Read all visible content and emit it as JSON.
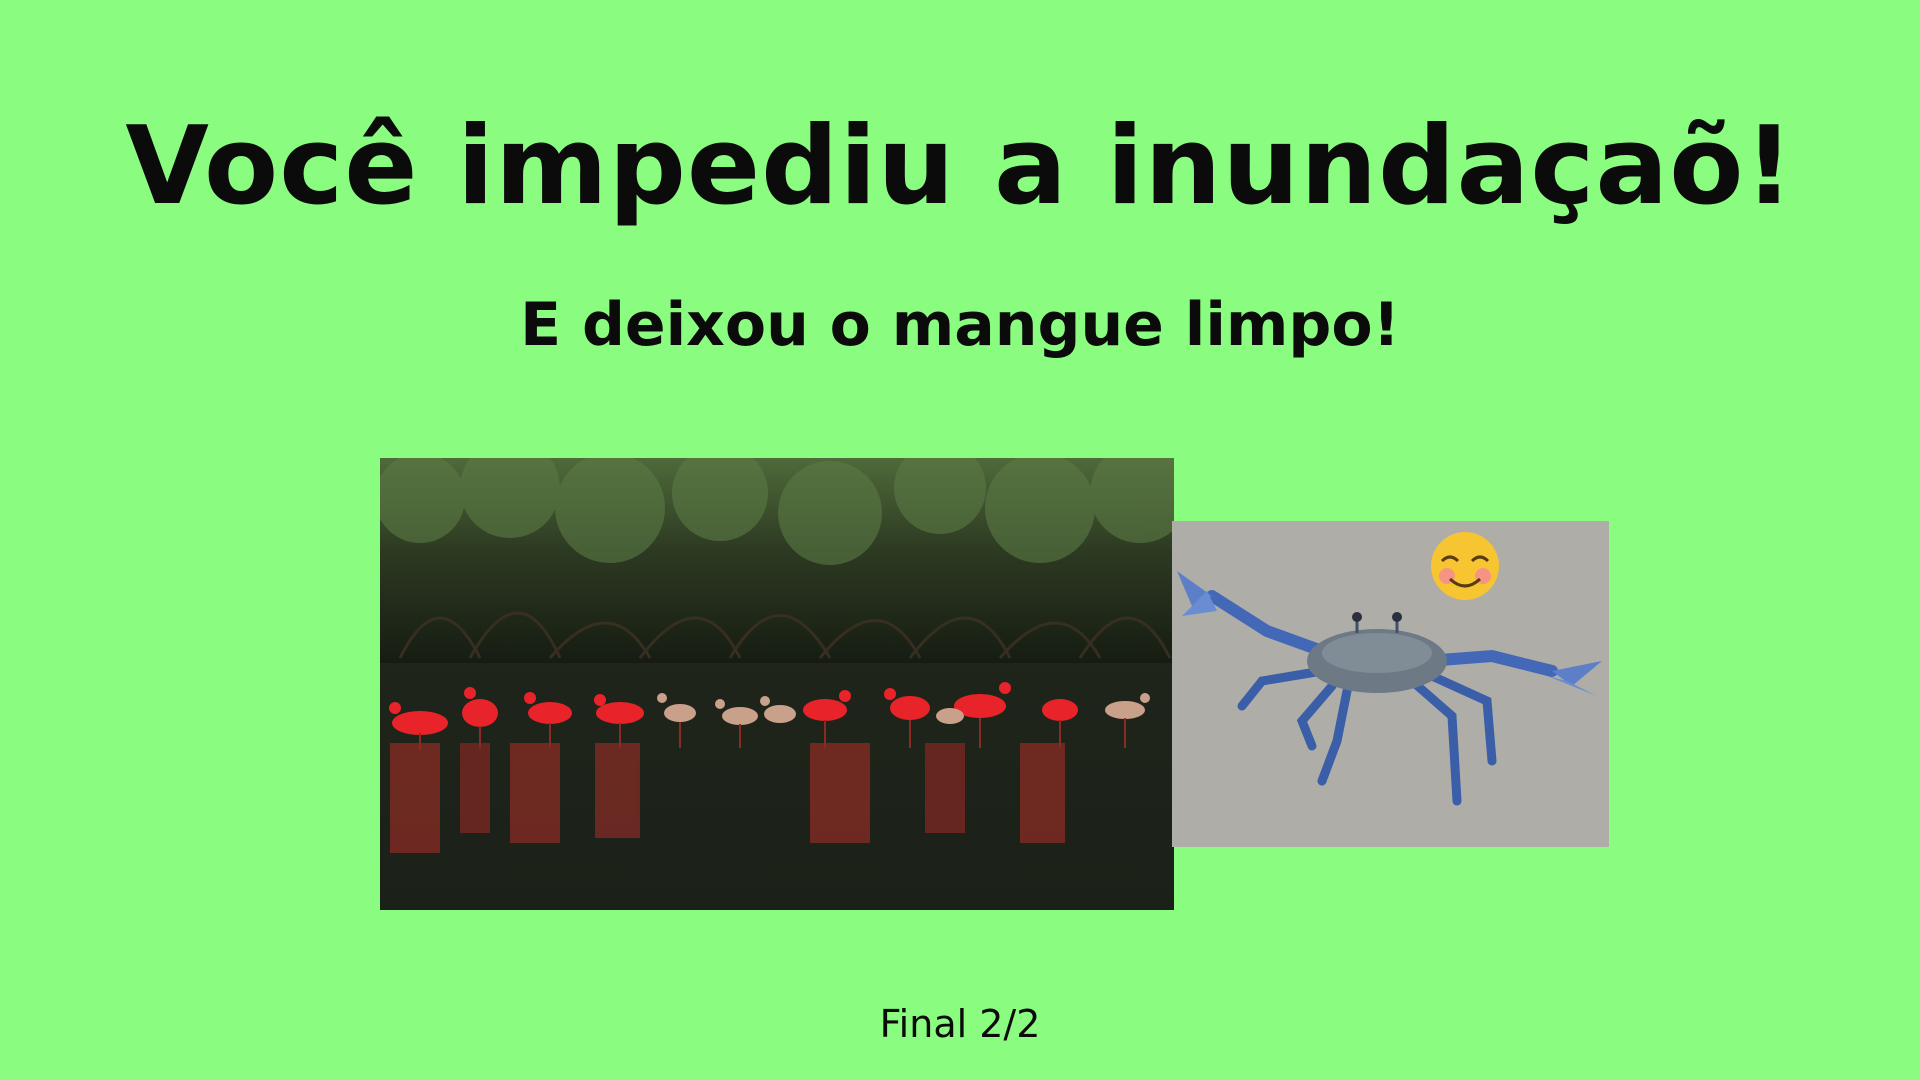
{
  "screen": {
    "title": "Você impediu a inundaçaõ!",
    "subtitle": "E deixou o mangue limpo!",
    "footer": "Final 2/2"
  },
  "images": {
    "mangrove_photo": "mangrove-with-scarlet-ibises-photo",
    "crab_photo": "blue-crab-on-sand-photo",
    "emoji": "smiling-face-icon"
  },
  "colors": {
    "background": "#8afd80",
    "text": "#0b0b0b"
  }
}
